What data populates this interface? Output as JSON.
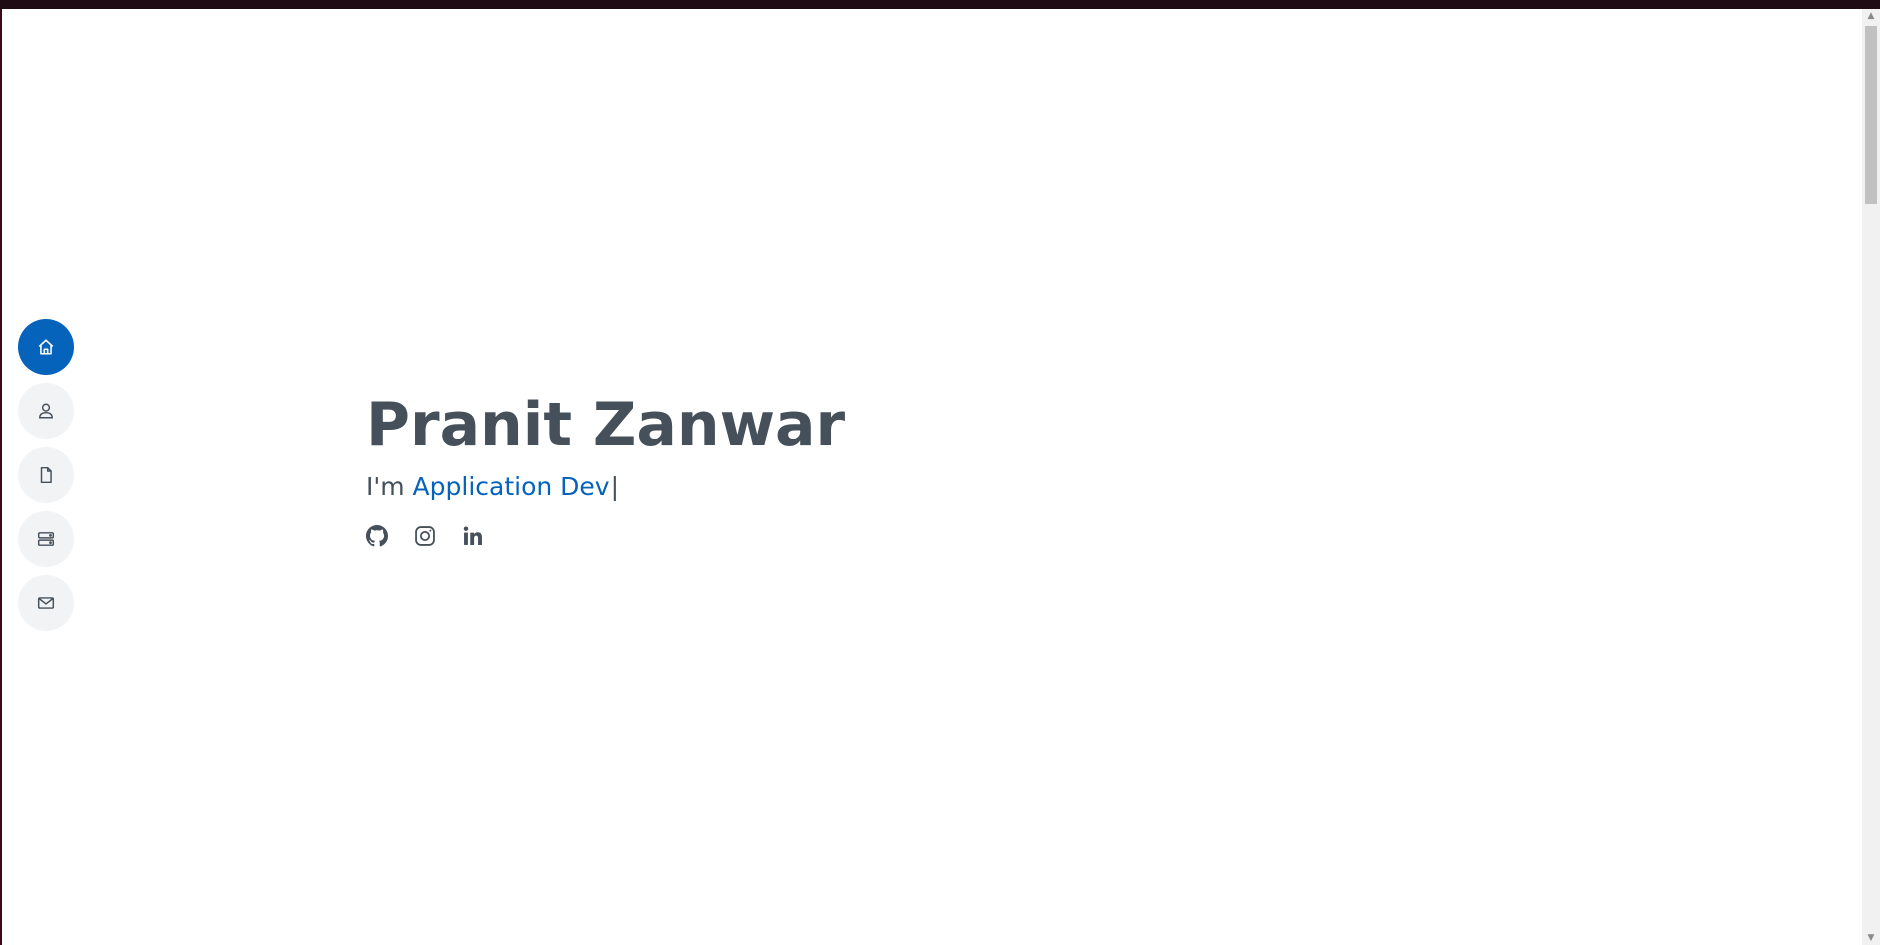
{
  "nav": {
    "items": [
      {
        "icon": "home-icon",
        "active": true
      },
      {
        "icon": "person-icon",
        "active": false
      },
      {
        "icon": "file-icon",
        "active": false
      },
      {
        "icon": "server-icon",
        "active": false
      },
      {
        "icon": "envelope-icon",
        "active": false
      }
    ]
  },
  "hero": {
    "name": "Pranit Zanwar",
    "prefix": "I'm ",
    "typed": "Application Dev",
    "cursor": "|"
  },
  "social": [
    {
      "icon": "github-icon"
    },
    {
      "icon": "instagram-icon"
    },
    {
      "icon": "linkedin-icon"
    }
  ],
  "colors": {
    "accent": "#0563bb",
    "text": "#45505b",
    "nav_bg": "#f2f3f5",
    "top_bar": "#1f0b13"
  }
}
